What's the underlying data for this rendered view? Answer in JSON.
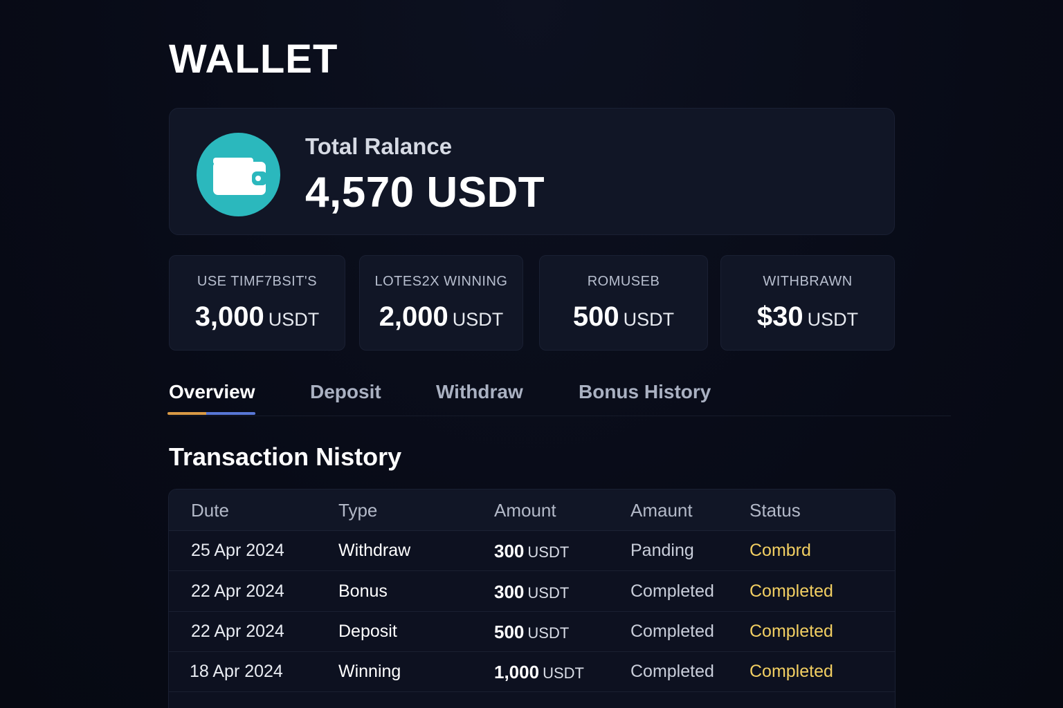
{
  "title": "WALLET",
  "balance": {
    "label": "Total Ralance",
    "value": "4,570 USDT",
    "icon": "wallet-icon",
    "icon_color": "#2bb8bd"
  },
  "stats": [
    {
      "label": "USE TIMF7BSIT'S",
      "amount": "3,000",
      "unit": "USDT"
    },
    {
      "label": "LOTES2X WINNING",
      "amount": "2,000",
      "unit": "USDT"
    },
    {
      "label": "ROMUSEB",
      "amount": "500",
      "unit": "USDT"
    },
    {
      "label": "WITHBRAWN",
      "amount": "$30",
      "unit": "USDT"
    }
  ],
  "tabs": [
    {
      "label": "Overview",
      "active": true
    },
    {
      "label": "Deposit",
      "active": false
    },
    {
      "label": "Withdraw",
      "active": false
    },
    {
      "label": "Bonus History",
      "active": false
    }
  ],
  "history": {
    "title": "Transaction Nistory",
    "columns": [
      "Dute",
      "Type",
      "Amount",
      "Amaunt",
      "Status"
    ],
    "rows": [
      {
        "date": "25 Apr 2024",
        "type": "Withdraw",
        "amount": "300",
        "unit": "USDT",
        "state": "Panding",
        "status": "Combrd"
      },
      {
        "date": "22 Apr 2024",
        "type": "Bonus",
        "amount": "300",
        "unit": "USDT",
        "state": "Completed",
        "status": "Completed"
      },
      {
        "date": "22 Apr 2024",
        "type": "Deposit",
        "amount": "500",
        "unit": "USDT",
        "state": "Completed",
        "status": "Completed"
      },
      {
        "date": "18 Apr 2024",
        "type": "Winning",
        "amount": "1,000",
        "unit": "USDT",
        "state": "Completed",
        "status": "Completed"
      }
    ]
  },
  "colors": {
    "background": "#080b17",
    "card": "#111626",
    "accent_teal": "#2bb8bd",
    "status_yellow": "#f2cf62",
    "tab_underline_orange": "#d99a45",
    "tab_underline_blue": "#5877d6"
  }
}
